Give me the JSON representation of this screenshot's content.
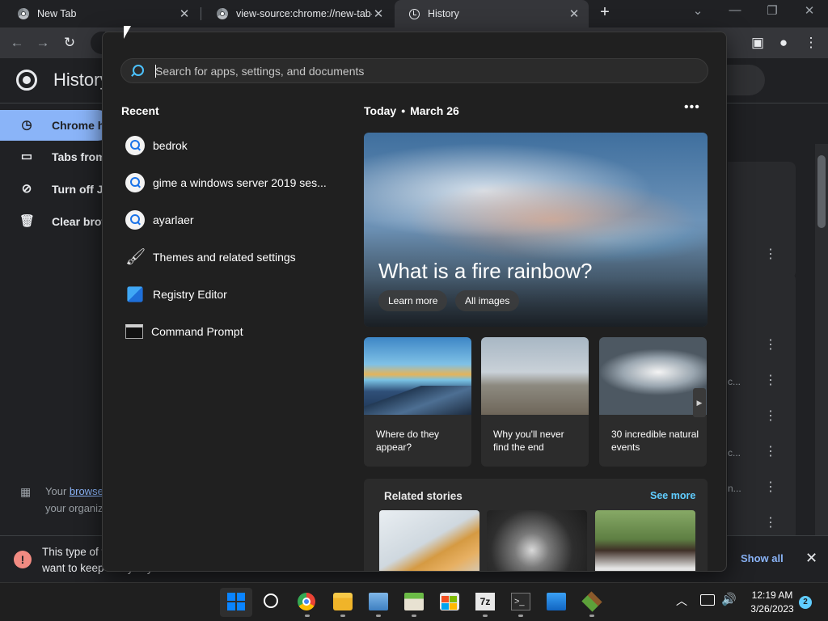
{
  "chrome": {
    "tabs": [
      {
        "title": "New Tab"
      },
      {
        "title": "view-source:chrome://new-tab-page"
      },
      {
        "title": "History"
      }
    ],
    "new_tab_glyph": "+",
    "history_page_title": "History",
    "sidebar": [
      {
        "label": "Chrome history"
      },
      {
        "label": "Tabs from other devices"
      },
      {
        "label": "Turn off Journeys"
      },
      {
        "label": "Clear browsing data"
      }
    ],
    "managed_prefix": "Your ",
    "managed_link": "browser",
    "managed_line2": "your organization",
    "truncated_snippets": [
      "c...",
      "c...",
      "n..."
    ],
    "download_bar": {
      "line1": "This type of file can harm your computer. Do you",
      "line2": "want to keep it anyway?",
      "show_all": "Show all"
    }
  },
  "search_flyout": {
    "search_placeholder": "Search for apps, settings, and documents",
    "recent_heading": "Recent",
    "recent_items": [
      {
        "label": "bedrok",
        "icon": "search-icon"
      },
      {
        "label": "gime a windows server 2019 ses...",
        "icon": "search-icon"
      },
      {
        "label": "ayarlaer",
        "icon": "search-icon"
      },
      {
        "label": "Themes and related settings",
        "icon": "brush-icon"
      },
      {
        "label": "Registry Editor",
        "icon": "registry-editor-icon"
      },
      {
        "label": "Command Prompt",
        "icon": "command-prompt-icon"
      }
    ],
    "today_label": "Today",
    "date_label": "March 26",
    "hero": {
      "title": "What is a fire rainbow?",
      "buttons": [
        "Learn more",
        "All images"
      ]
    },
    "story_cards": [
      {
        "caption": "Where do they appear?"
      },
      {
        "caption": "Why you'll never find the end"
      },
      {
        "caption": "30 incredible natural events"
      }
    ],
    "related_heading": "Related stories",
    "see_more": "See more"
  },
  "taskbar": {
    "apps": [
      "start",
      "search",
      "google-chrome",
      "file-explorer",
      "performance-monitor",
      "minecraft-launcher",
      "microsoft-store",
      "7-zip",
      "terminal",
      "mail",
      "minecraft"
    ],
    "sevenzip_label": "7z",
    "terminal_label": ">_",
    "clock_time": "12:19 AM",
    "clock_date": "3/26/2023",
    "notification_count": "2"
  },
  "colors": {
    "flyout_bg": "#202020",
    "accent": "#60cdff",
    "chrome_selected": "#8ab4f8",
    "warning": "#f28b82"
  }
}
